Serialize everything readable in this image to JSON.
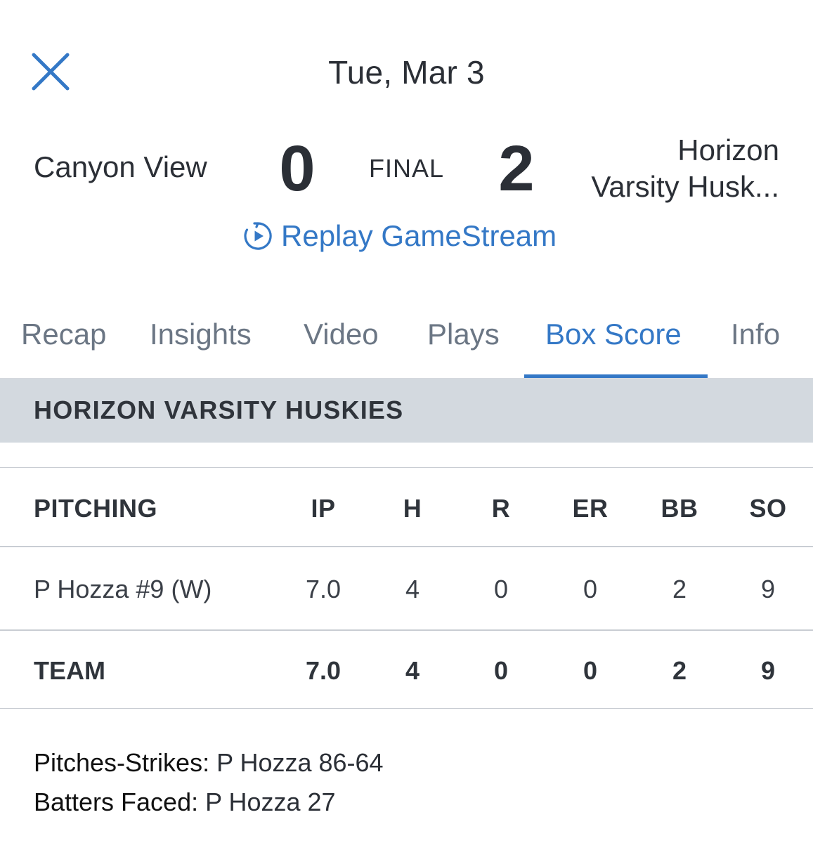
{
  "header": {
    "date": "Tue, Mar 3"
  },
  "scoreboard": {
    "away_team": "Canyon View",
    "away_score": "0",
    "status": "FINAL",
    "home_score": "2",
    "home_team_line1": "Horizon",
    "home_team_line2": "Varsity Husk..."
  },
  "replay": {
    "label": "Replay GameStream",
    "icon": "replay-play-icon"
  },
  "tabs": [
    {
      "label": "Recap"
    },
    {
      "label": "Insights"
    },
    {
      "label": "Video"
    },
    {
      "label": "Plays"
    },
    {
      "label": "Box Score",
      "active": true
    },
    {
      "label": "Info"
    }
  ],
  "team_section": {
    "title": "HORIZON VARSITY HUSKIES"
  },
  "pitching_table": {
    "columns": [
      "PITCHING",
      "IP",
      "H",
      "R",
      "ER",
      "BB",
      "SO"
    ],
    "rows": [
      [
        "P Hozza #9 (W)",
        "7.0",
        "4",
        "0",
        "0",
        "2",
        "9"
      ]
    ],
    "team_row": [
      "TEAM",
      "7.0",
      "4",
      "0",
      "0",
      "2",
      "9"
    ]
  },
  "notes": {
    "pitches_strikes_label": "Pitches-Strikes:",
    "pitches_strikes_value": "P Hozza 86-64",
    "batters_faced_label": "Batters Faced:",
    "batters_faced_value": "P Hozza 27"
  },
  "colors": {
    "accent": "#3478c6",
    "section_bg": "#d3d9df",
    "text": "#2b2f36",
    "inactive_tab": "#6b7684"
  }
}
